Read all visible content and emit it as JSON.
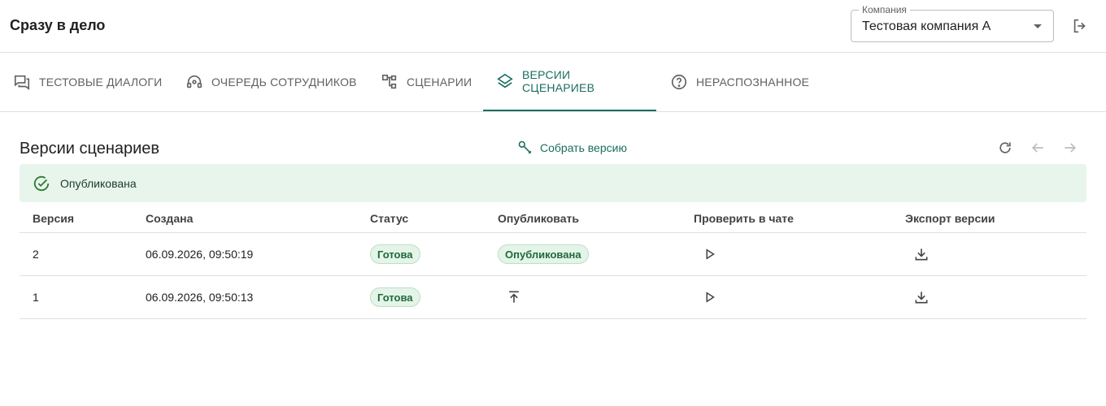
{
  "header": {
    "title": "Сразу в дело",
    "company_label": "Компания",
    "company_value": "Тестовая компания А"
  },
  "tabs": [
    {
      "label": "ТЕСТОВЫЕ ДИАЛОГИ",
      "icon": "chat-icon"
    },
    {
      "label": "ОЧЕРЕДЬ СОТРУДНИКОВ",
      "icon": "headset-icon"
    },
    {
      "label": "СЦЕНАРИИ",
      "icon": "flowchart-icon"
    },
    {
      "label": "ВЕРСИИ СЦЕНАРИЕВ",
      "icon": "layers-icon",
      "active": true
    },
    {
      "label": "НЕРАСПОЗНАННОЕ",
      "icon": "question-circle-icon"
    }
  ],
  "section": {
    "title": "Версии сценариев",
    "build_label": "Собрать версию"
  },
  "alert": {
    "text": "Опубликована"
  },
  "table": {
    "columns": [
      "Версия",
      "Создана",
      "Статус",
      "Опубликовать",
      "Проверить в чате",
      "Экспорт версии"
    ],
    "rows": [
      {
        "version": "2",
        "created": "06.09.2026, 09:50:19",
        "status": "Готова",
        "publish": "Опубликована"
      },
      {
        "version": "1",
        "created": "06.09.2026, 09:50:13",
        "status": "Готова",
        "publish": ""
      }
    ]
  },
  "colors": {
    "accent": "#1b6e5f",
    "success_bg": "#e8f5ec",
    "chip_bg": "#e5f4e9",
    "chip_text": "#1e6b3a"
  }
}
